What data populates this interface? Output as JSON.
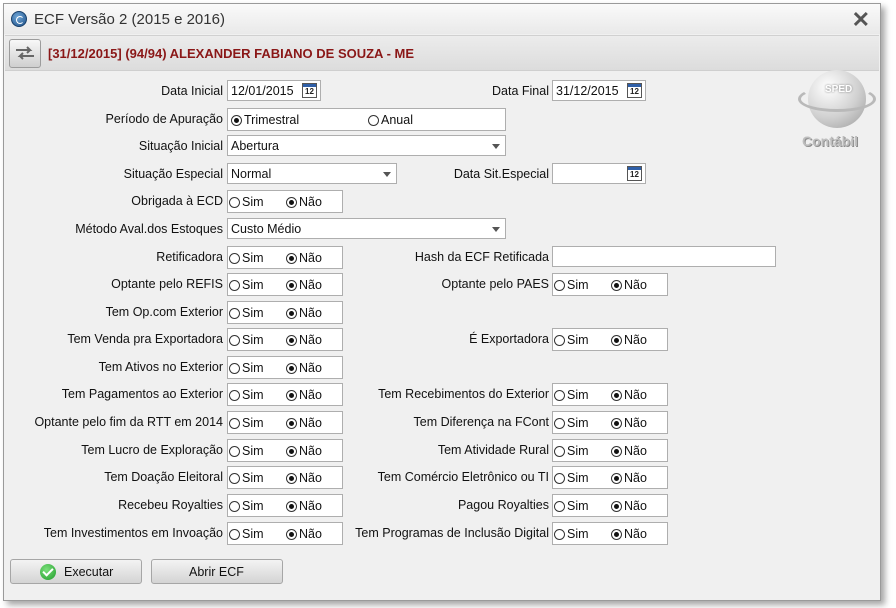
{
  "window": {
    "title": "ECF Versão 2 (2015 e 2016)"
  },
  "header": {
    "title": "[31/12/2015] (94/94) ALEXANDER FABIANO DE SOUZA - ME"
  },
  "logo": {
    "badge": "SPED",
    "caption": "Contábil"
  },
  "icons": {
    "calendar_text": "12"
  },
  "radio": {
    "sim": "Sim",
    "nao": "Não"
  },
  "form": {
    "data_inicial": {
      "label": "Data Inicial",
      "value": "12/01/2015"
    },
    "data_final": {
      "label": "Data Final",
      "value": "31/12/2015"
    },
    "periodo": {
      "label": "Período de Apuração",
      "options": [
        "Trimestral",
        "Anual"
      ],
      "selected": "Trimestral"
    },
    "situacao_inicial": {
      "label": "Situação Inicial",
      "value": "Abertura"
    },
    "situacao_especial": {
      "label": "Situação Especial",
      "value": "Normal"
    },
    "data_sit_especial": {
      "label": "Data Sit.Especial",
      "value": ""
    },
    "obrigada_ecd": {
      "label": "Obrigada à ECD",
      "selected": "Não"
    },
    "metodo_aval": {
      "label": "Método Aval.dos Estoques",
      "value": "Custo Médio"
    },
    "retificadora": {
      "label": "Retificadora",
      "selected": "Não"
    },
    "hash_ecf": {
      "label": "Hash da ECF Retificada",
      "value": ""
    },
    "optante_refis": {
      "label": "Optante pelo REFIS",
      "selected": "Não"
    },
    "optante_paes": {
      "label": "Optante pelo PAES",
      "selected": "Não"
    },
    "tem_op_exterior": {
      "label": "Tem Op.com Exterior",
      "selected": "Não"
    },
    "tem_venda_exportadora": {
      "label": "Tem Venda pra Exportadora",
      "selected": "Não"
    },
    "e_exportadora": {
      "label": "É Exportadora",
      "selected": "Não"
    },
    "tem_ativos_exterior": {
      "label": "Tem Ativos no Exterior",
      "selected": "Não"
    },
    "tem_pagamentos_exterior": {
      "label": "Tem Pagamentos ao Exterior",
      "selected": "Não"
    },
    "tem_recebimentos_exterior": {
      "label": "Tem Recebimentos do Exterior",
      "selected": "Não"
    },
    "optante_fim_rtt": {
      "label": "Optante pelo fim da RTT em 2014",
      "selected": "Não"
    },
    "tem_diferenca_fcont": {
      "label": "Tem Diferença na FCont",
      "selected": "Não"
    },
    "tem_lucro_exploracao": {
      "label": "Tem Lucro de Exploração",
      "selected": "Não"
    },
    "tem_atividade_rural": {
      "label": "Tem Atividade Rural",
      "selected": "Não"
    },
    "tem_doacao_eleitoral": {
      "label": "Tem Doação Eleitoral",
      "selected": "Não"
    },
    "tem_comercio_eletronico": {
      "label": "Tem Comércio Eletrônico ou TI",
      "selected": "Não"
    },
    "recebeu_royalties": {
      "label": "Recebeu Royalties",
      "selected": "Não"
    },
    "pagou_royalties": {
      "label": "Pagou Royalties",
      "selected": "Não"
    },
    "tem_investimentos_inovacao": {
      "label": "Tem Investimentos em Invoação",
      "selected": "Não"
    },
    "tem_programas_inclusao": {
      "label": "Tem Programas de Inclusão Digital",
      "selected": "Não"
    }
  },
  "buttons": {
    "executar": "Executar",
    "abrir_ecf": "Abrir ECF"
  }
}
